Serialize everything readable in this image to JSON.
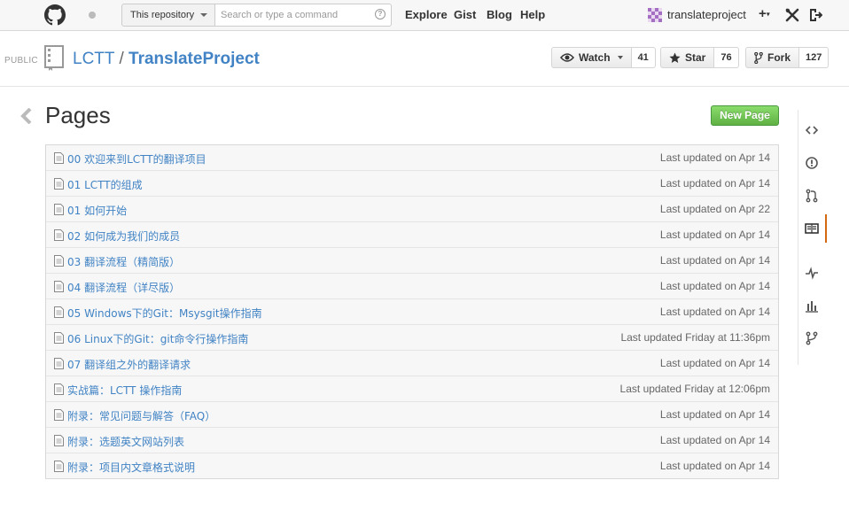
{
  "header": {
    "scope_label": "This repository",
    "search_placeholder": "Search or type a command",
    "help_symbol": "?",
    "nav": [
      "Explore",
      "Gist",
      "Blog",
      "Help"
    ],
    "username": "translateproject",
    "create_symbol": "+"
  },
  "repo": {
    "visibility": "PUBLIC",
    "owner": "LCTT",
    "separator": "/",
    "name": "TranslateProject",
    "watch_label": "Watch",
    "watch_count": "41",
    "star_label": "Star",
    "star_count": "76",
    "fork_label": "Fork",
    "fork_count": "127"
  },
  "main": {
    "title": "Pages",
    "new_page_label": "New Page",
    "pages": [
      {
        "title": "00 欢迎来到LCTT的翻译项目",
        "updated": "Last updated on Apr 14"
      },
      {
        "title": "01 LCTT的组成",
        "updated": "Last updated on Apr 14"
      },
      {
        "title": "01 如何开始",
        "updated": "Last updated on Apr 22"
      },
      {
        "title": "02 如何成为我们的成员",
        "updated": "Last updated on Apr 14"
      },
      {
        "title": "03 翻译流程（精简版）",
        "updated": "Last updated on Apr 14"
      },
      {
        "title": "04 翻译流程（详尽版）",
        "updated": "Last updated on Apr 14"
      },
      {
        "title": "05 Windows下的Git：Msysgit操作指南",
        "updated": "Last updated on Apr 14"
      },
      {
        "title": "06 Linux下的Git：git命令行操作指南",
        "updated": "Last updated Friday at 11:36pm"
      },
      {
        "title": "07 翻译组之外的翻译请求",
        "updated": "Last updated on Apr 14"
      },
      {
        "title": "实战篇：LCTT 操作指南",
        "updated": "Last updated Friday at 12:06pm"
      },
      {
        "title": "附录：常见问题与解答（FAQ）",
        "updated": "Last updated on Apr 14"
      },
      {
        "title": "附录：选题英文网站列表",
        "updated": "Last updated on Apr 14"
      },
      {
        "title": "附录：项目内文章格式说明",
        "updated": "Last updated on Apr 14"
      }
    ]
  },
  "sidebar": {
    "icons": [
      "code-icon",
      "issues-icon",
      "pull-requests-icon",
      "wiki-icon",
      "pulse-icon",
      "graphs-icon",
      "network-icon"
    ],
    "active": "wiki-icon"
  },
  "colors": {
    "link": "#4183c4",
    "new_page_green": "#60b044",
    "active_tab": "#d26911"
  }
}
